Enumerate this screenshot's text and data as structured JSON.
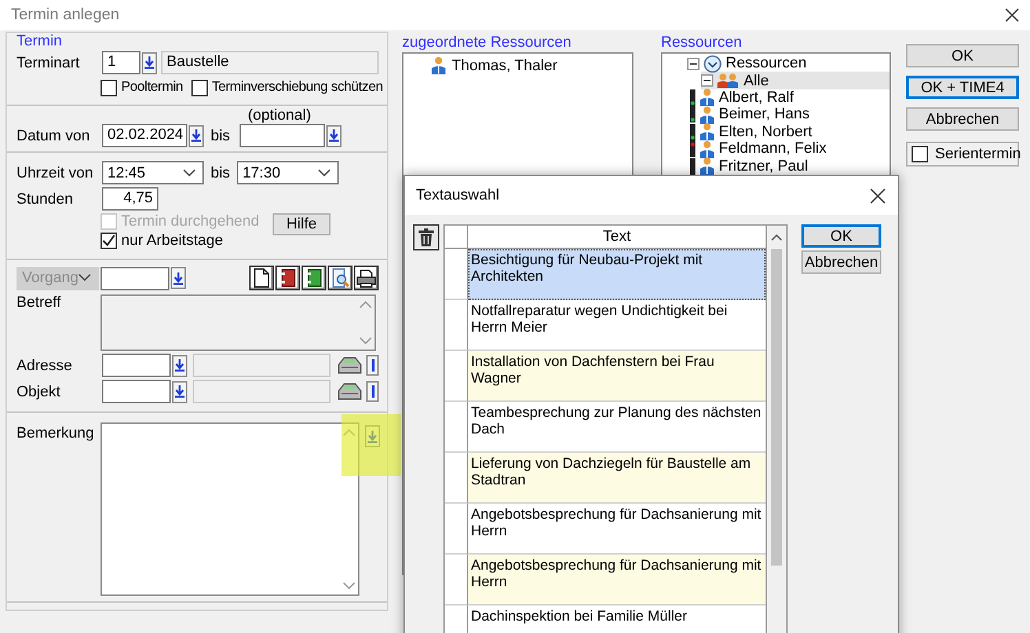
{
  "window": {
    "title": "Termin anlegen"
  },
  "termin": {
    "legend": "Termin",
    "type_label": "Terminart",
    "type_value": "1",
    "type_name": "Baustelle",
    "flags": [
      {
        "label": "Pooltermin",
        "checked": false
      },
      {
        "label": "Terminverschiebung schützen",
        "checked": false
      }
    ],
    "date_label": "Datum von",
    "date_from": "02.02.2024",
    "date_to_label": "bis",
    "date_to_hint": "(optional)",
    "time_label": "Uhrzeit von",
    "time_from": "12:45",
    "time_to_label": "bis",
    "time_to": "17:30",
    "hours_label": "Stunden",
    "hours": "4,75",
    "options": [
      {
        "label": "Termin durchgehend",
        "checked": false,
        "disabled": true
      },
      {
        "label": "nur Arbeitstage",
        "checked": true,
        "disabled": false
      }
    ],
    "help_button": "Hilfe"
  },
  "vorgang": {
    "select": "Vorgang",
    "disabled": true,
    "subject_label": "Betreff",
    "address_label": "Adresse",
    "object_label": "Objekt"
  },
  "remark": {
    "label": "Bemerkung",
    "highlighted": true
  },
  "assigned": {
    "legend": "zugeordnete Ressourcen",
    "items": [
      {
        "name": "Thomas, Thaler"
      }
    ]
  },
  "resources": {
    "legend": "Ressourcen",
    "tree": [
      {
        "label": "Ressourcen",
        "kind": "root",
        "expanded": true,
        "selected": false,
        "children": [
          {
            "label": "Alle",
            "kind": "group",
            "expanded": true,
            "selected": true,
            "children": [
              {
                "label": "Albert, Ralf",
                "kind": "person",
                "selected": false,
                "color": "#22b14c"
              },
              {
                "label": "Beimer, Hans",
                "kind": "person",
                "selected": false,
                "color": "#22b14c"
              },
              {
                "label": "Elten, Norbert",
                "kind": "person",
                "selected": false,
                "color": "#22b14c"
              },
              {
                "label": "Feldmann, Felix",
                "kind": "person",
                "selected": false,
                "color": "#e01010"
              },
              {
                "label": "Fritzner, Paul",
                "kind": "person",
                "selected": false
              }
            ]
          }
        ]
      }
    ]
  },
  "actions": [
    {
      "label": "OK",
      "focused": false
    },
    {
      "label": "OK + TIME4",
      "focused": true
    },
    {
      "label": "Abbrechen",
      "focused": false
    }
  ],
  "series": {
    "label": "Serientermin",
    "checked": false
  },
  "dialog": {
    "title": "Textauswahl",
    "column": "Text",
    "rows": [
      {
        "text": "Besichtigung für Neubau-Projekt mit Architekten",
        "selected": true,
        "shaded": false
      },
      {
        "text": "Notfallreparatur wegen Undichtigkeit bei Herrn Meier",
        "selected": false,
        "shaded": false
      },
      {
        "text": "Installation von Dachfenstern bei Frau Wagner",
        "selected": false,
        "shaded": true
      },
      {
        "text": "Teambesprechung zur Planung des nächsten Dach",
        "selected": false,
        "shaded": false
      },
      {
        "text": "Lieferung von Dachziegeln für Baustelle am Stadtran",
        "selected": false,
        "shaded": true
      },
      {
        "text": "Angebotsbesprechung für Dachsanierung mit Herrn",
        "selected": false,
        "shaded": false
      },
      {
        "text": "Angebotsbesprechung für Dachsanierung mit Herrn",
        "selected": false,
        "shaded": true
      },
      {
        "text": "Dachinspektion bei Familie Müller",
        "selected": false,
        "shaded": false
      }
    ],
    "buttons": [
      {
        "label": "OK",
        "focused": true
      },
      {
        "label": "Abbrechen",
        "focused": false
      }
    ]
  }
}
